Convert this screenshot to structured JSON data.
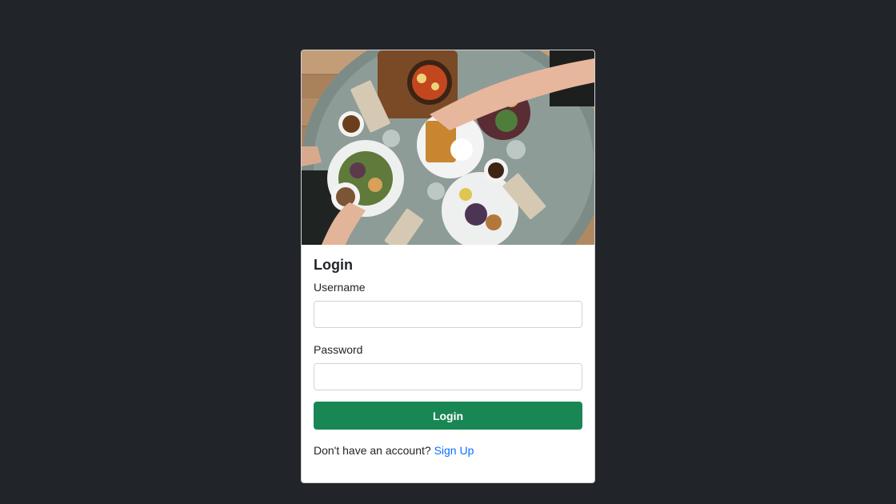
{
  "login_card": {
    "hero_image_icon": "food-table-photo",
    "title": "Login",
    "username_label": "Username",
    "username_value": "",
    "password_label": "Password",
    "password_value": "",
    "submit_label": "Login",
    "signup_prompt": "Don't have an account?",
    "signup_link": "Sign Up"
  },
  "colors": {
    "page_background": "#212529",
    "card_background": "#ffffff",
    "primary_button": "#198754",
    "link": "#0d6efd",
    "text": "#212529"
  }
}
